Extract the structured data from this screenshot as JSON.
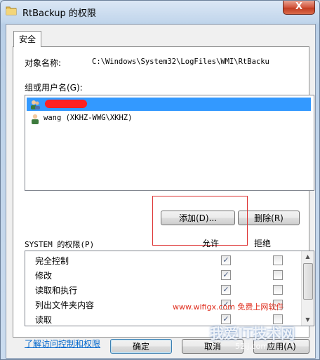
{
  "window": {
    "title": "RtBackup 的权限",
    "close_label": "X"
  },
  "tabs": [
    {
      "label": "安全"
    }
  ],
  "object": {
    "label": "对象名称:",
    "value": "C:\\Windows\\System32\\LogFiles\\WMI\\RtBacku"
  },
  "groups": {
    "label": "组或用户名(G):",
    "users": [
      {
        "name": "",
        "selected": true,
        "redacted": true,
        "icon": "user-group-icon"
      },
      {
        "name": "wang (XKHZ-WWG\\XKHZ)",
        "selected": false,
        "icon": "user-icon"
      }
    ]
  },
  "buttons": {
    "add": "添加(D)...",
    "remove": "删除(R)",
    "ok": "确定",
    "cancel": "取消",
    "apply": "应用(A)"
  },
  "permissions": {
    "label": "SYSTEM 的权限(P)",
    "allow_header": "允许",
    "deny_header": "拒绝",
    "rows": [
      {
        "name": "完全控制",
        "allow": true,
        "deny": false
      },
      {
        "name": "修改",
        "allow": true,
        "deny": false
      },
      {
        "name": "读取和执行",
        "allow": true,
        "deny": false
      },
      {
        "name": "列出文件夹内容",
        "allow": true,
        "deny": false
      },
      {
        "name": "读取",
        "allow": true,
        "deny": false
      }
    ]
  },
  "help_link": "了解访问控制和权限",
  "watermark": {
    "url": "www.wifigx.com 免费上网软件",
    "brand": "我爱IT技术网",
    "domain": "52ij.com"
  },
  "colors": {
    "selection": "#3399ff",
    "annotation": "#dd3333",
    "watermark": "#e03020"
  }
}
